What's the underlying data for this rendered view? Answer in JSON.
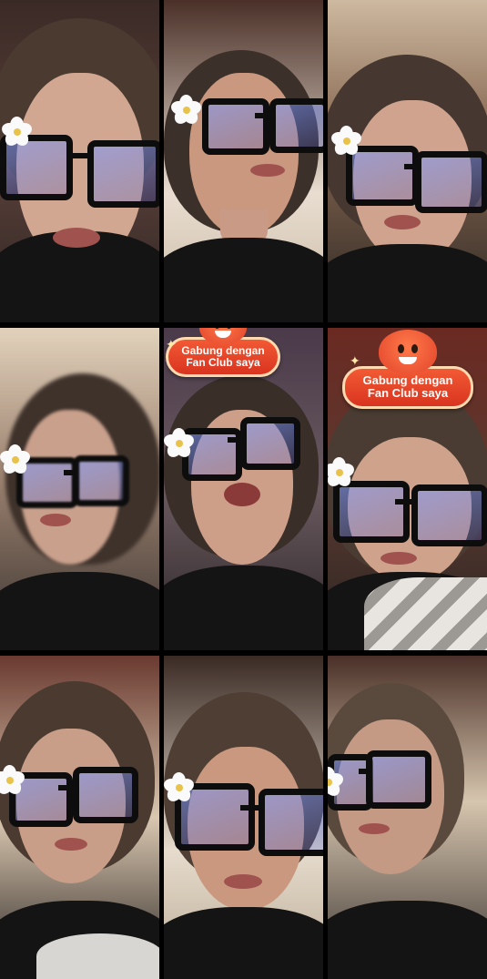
{
  "badge": {
    "line1": "Gabung dengan",
    "line2": "Fan Club saya"
  },
  "colors": {
    "separator": "#000000",
    "badge_fill": "#e8442a",
    "badge_border": "#ffd9b0",
    "lens_tint": "#6a86f0",
    "shirt": "#141414"
  },
  "icons": {
    "flower": "white-flower-hair-clip-icon",
    "mascot": "orange-mascot-face-icon",
    "sparkle": "sparkle-icon"
  },
  "grid": {
    "rows": 3,
    "columns": 3
  }
}
